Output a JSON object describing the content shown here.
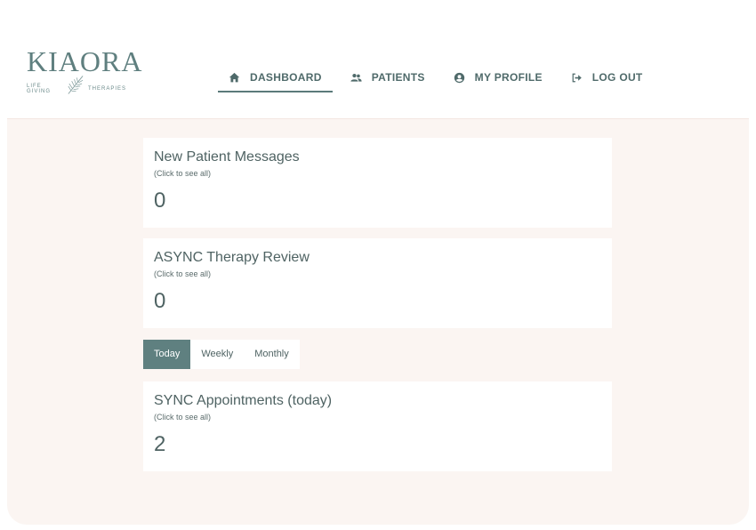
{
  "brand": {
    "name": "KIAORA",
    "tagline_left": "LIFE GIVING",
    "tagline_right": "THERAPIES"
  },
  "nav": {
    "items": [
      {
        "label": "DASHBOARD",
        "icon": "home-icon",
        "active": true
      },
      {
        "label": "PATIENTS",
        "icon": "users-icon",
        "active": false
      },
      {
        "label": "MY PROFILE",
        "icon": "user-circle-icon",
        "active": false
      },
      {
        "label": "LOG OUT",
        "icon": "logout-icon",
        "active": false
      }
    ]
  },
  "cards": {
    "messages": {
      "title": "New Patient Messages",
      "subtitle": "(Click to see all)",
      "count": "0"
    },
    "async": {
      "title": "ASYNC Therapy Review",
      "subtitle": "(Click to see all)",
      "count": "0"
    },
    "sync": {
      "title": "SYNC Appointments (today)",
      "subtitle": "(Click to see all)",
      "count": "2"
    }
  },
  "range_tabs": {
    "items": [
      "Today",
      "Weekly",
      "Monthly"
    ],
    "selected": "Today"
  },
  "colors": {
    "accent": "#5f8080",
    "background": "#fbf5f2",
    "text": "#4f6363"
  }
}
